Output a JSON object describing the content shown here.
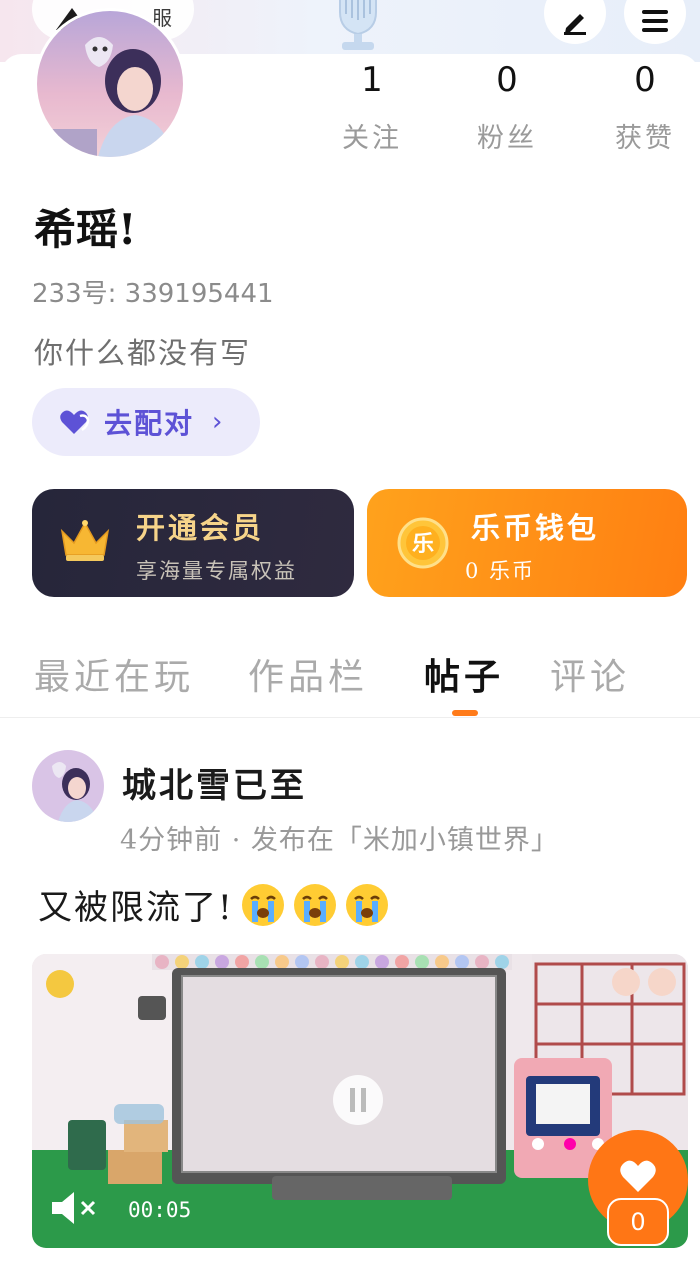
{
  "header": {
    "partial_label": "服"
  },
  "profile": {
    "stats": [
      {
        "value": "1",
        "label": "关注"
      },
      {
        "value": "0",
        "label": "粉丝"
      },
      {
        "value": "0",
        "label": "获赞"
      }
    ],
    "name": "希瑶!",
    "uid": "233号: 339195441",
    "bio": "你什么都没有写",
    "pair_label": "去配对",
    "pair_chevron": "›"
  },
  "vip_card": {
    "title": "开通会员",
    "subtitle": "享海量专属权益"
  },
  "wallet_card": {
    "coin_glyph": "乐",
    "title": "乐币钱包",
    "subtitle": "0 乐币"
  },
  "tabs": [
    {
      "label": "最近在玩"
    },
    {
      "label": "作品栏"
    },
    {
      "label": "帖子"
    },
    {
      "label": "评论"
    }
  ],
  "active_tab": "帖子",
  "post": {
    "author": "城北雪已至",
    "meta": "4分钟前 · 发布在「米加小镇世界」",
    "text": "又被限流了!",
    "emoji_count": 3,
    "video_time": "00:05",
    "like_count": "0"
  },
  "colors": {
    "accent": "#ff7b1a",
    "pair": "#5d52d6",
    "vip_gold": "#f6d48a"
  }
}
